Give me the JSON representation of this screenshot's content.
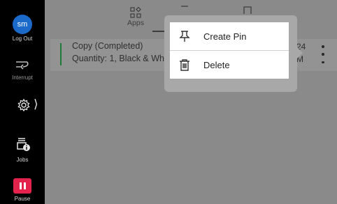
{
  "sidebar": {
    "user_initials": "sm",
    "logout_label": "Log Out",
    "interrupt_label": "Interrupt",
    "jobs_label": "Jobs",
    "pause_label": "Pause",
    "settings_chevron": "⟩"
  },
  "tabs": {
    "apps_label": "Apps"
  },
  "job": {
    "title": "Copy (Completed)",
    "detail": "Quantity: 1, Black & White",
    "time_line1": "24",
    "time_line2": "M"
  },
  "menu": {
    "items": [
      {
        "label": "Create Pin",
        "icon": "pin-icon"
      },
      {
        "label": "Delete",
        "icon": "trash-icon"
      }
    ]
  },
  "colors": {
    "avatar": "#1b6ac9",
    "pause": "#e3234c",
    "status_accent": "#1f7a3a"
  }
}
